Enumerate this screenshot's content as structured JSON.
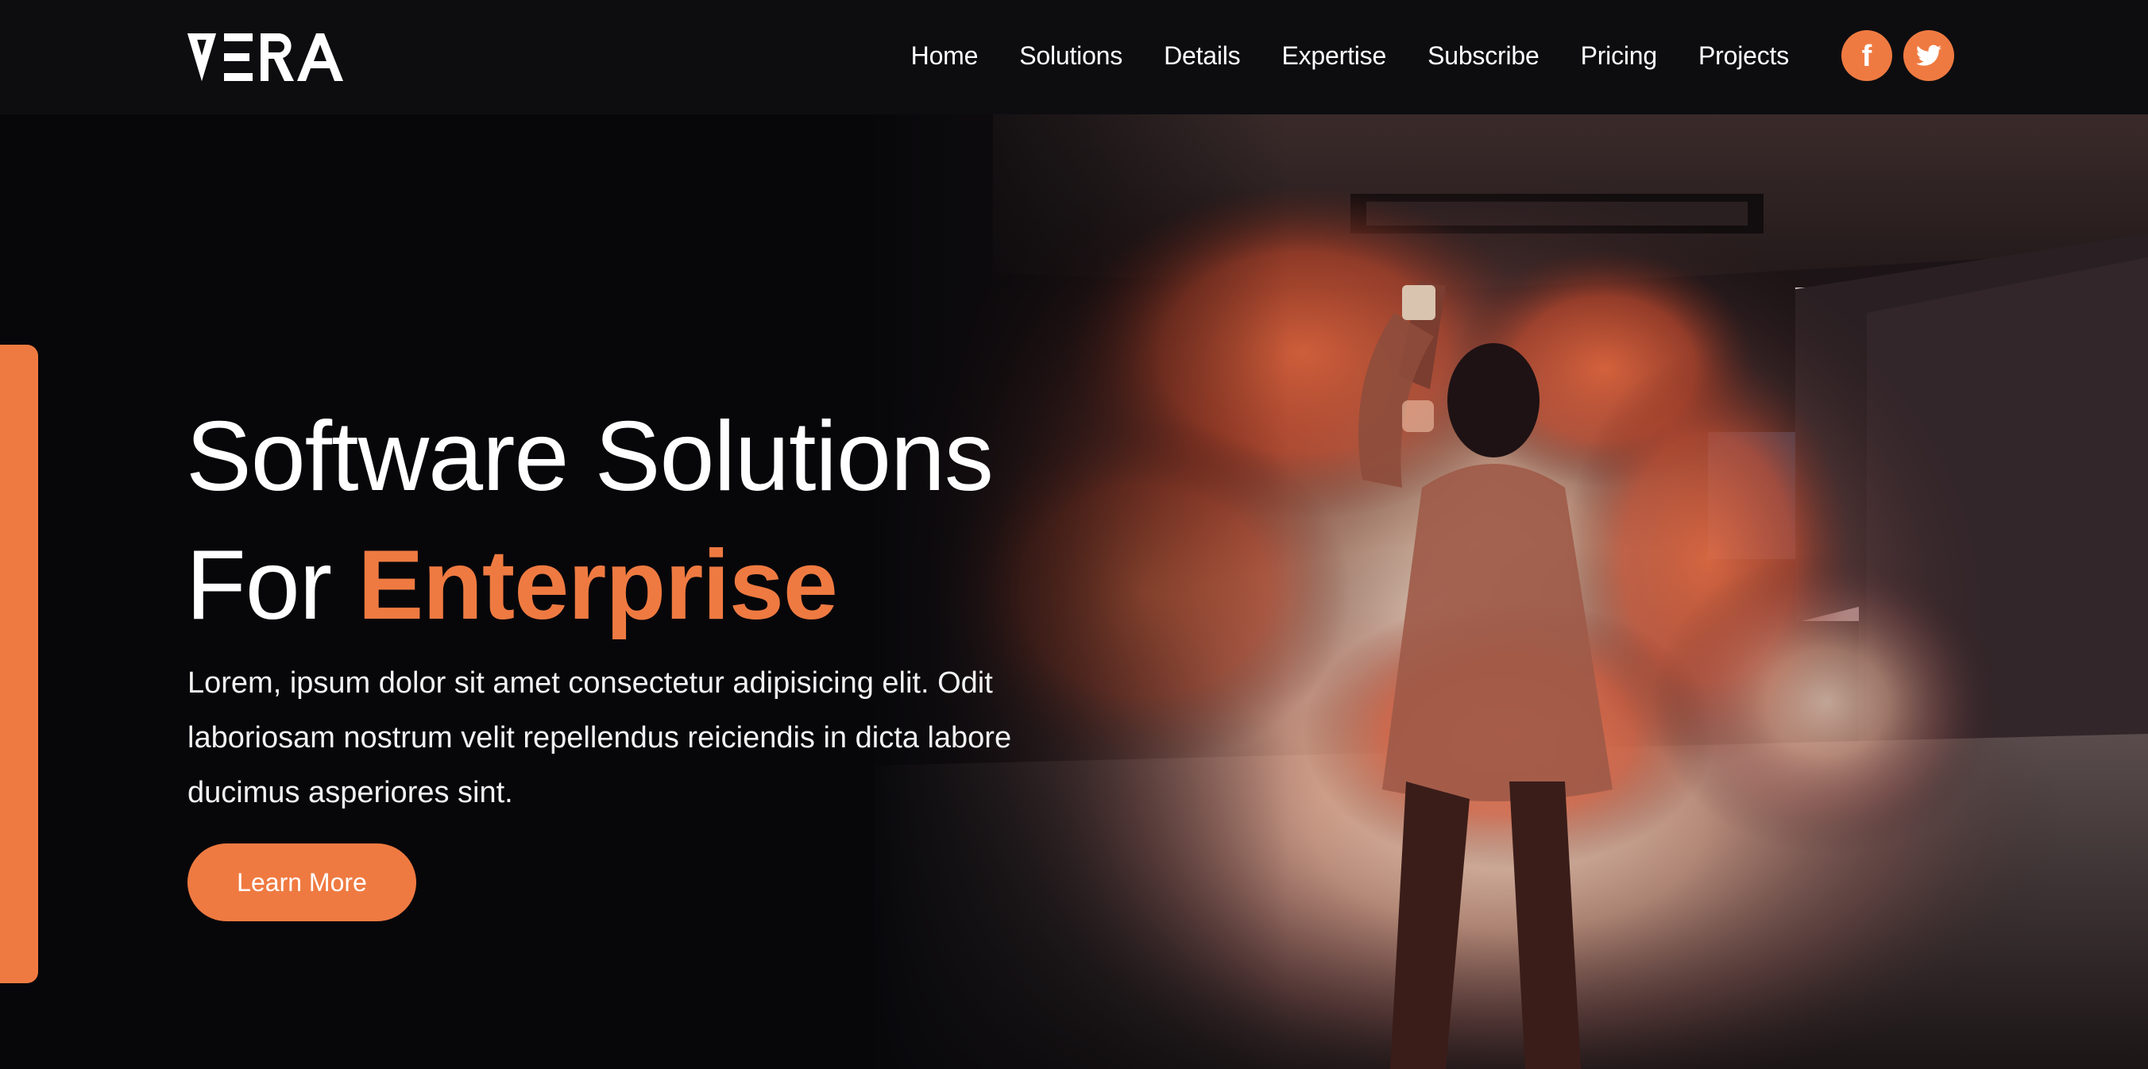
{
  "brand": {
    "name": "VERA"
  },
  "nav": {
    "items": [
      {
        "label": "Home"
      },
      {
        "label": "Solutions"
      },
      {
        "label": "Details"
      },
      {
        "label": "Expertise"
      },
      {
        "label": "Subscribe"
      },
      {
        "label": "Pricing"
      },
      {
        "label": "Projects"
      }
    ],
    "social": [
      {
        "icon": "facebook-icon",
        "glyph": "f"
      },
      {
        "icon": "twitter-icon"
      }
    ]
  },
  "hero": {
    "title_line1": "Software Solutions",
    "title_line2_prefix": "For ",
    "title_line2_accent": "Enterprise",
    "lead": "Lorem, ipsum dolor sit amet consectetur adipisicing elit. Odit laboriosam nostrum velit repellendus reiciendis in dicta labore ducimus asperiores sint.",
    "cta_label": "Learn More",
    "image": "person holding orange smoke flare in concrete tunnel"
  },
  "colors": {
    "accent": "#ef7a41",
    "background": "#07070a",
    "header": "#0d0d10",
    "text": "#ffffff"
  }
}
